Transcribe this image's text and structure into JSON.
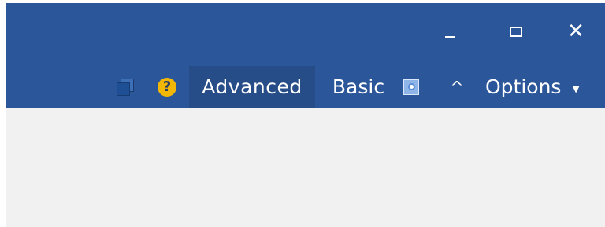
{
  "colors": {
    "titlebar": "#2b579a",
    "active_tab": "#264d88",
    "content_bg": "#f1f1f1",
    "help_icon": "#f2b705"
  },
  "window_controls": {
    "minimize_icon": "minimize-icon",
    "maximize_icon": "maximize-icon",
    "close_icon": "close-icon",
    "close_glyph": "✕"
  },
  "ribbon": {
    "restore_icon": "restore-windows-icon",
    "help_icon": "help-icon",
    "help_glyph": "?",
    "tabs": [
      {
        "label": "Advanced",
        "selected": true
      },
      {
        "label": "Basic",
        "selected": false
      }
    ],
    "settings_icon": "settings-icon",
    "collapse_icon": "chevron-up-icon",
    "collapse_glyph": "^",
    "options_label": "Options",
    "options_dropdown_glyph": "▼"
  }
}
